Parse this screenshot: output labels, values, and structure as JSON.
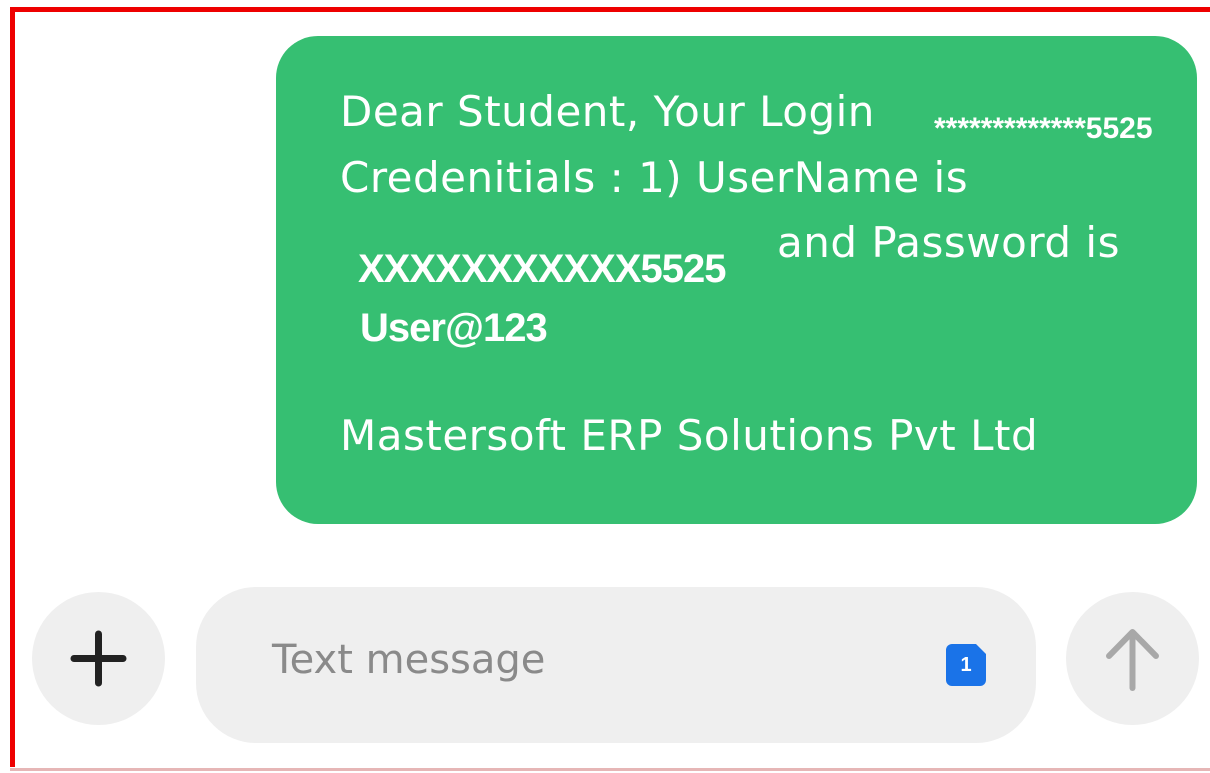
{
  "message": {
    "line1": "Dear Student, Your Login",
    "line2": "Credenitials : 1) UserName is",
    "line3_right": "and Password is",
    "sender": "Mastersoft ERP Solutions Pvt Ltd",
    "masked_number": "*************5525",
    "username_value": "XXXXXXXXXXX5525",
    "password_value": "User@123"
  },
  "composer": {
    "placeholder": "Text message",
    "sim_label": "1"
  },
  "icons": {
    "attach": "plus-icon",
    "send": "arrow-up-icon"
  },
  "colors": {
    "bubble": "#36bf72",
    "frame": "#ee0000",
    "sim_badge": "#1a73e8"
  }
}
